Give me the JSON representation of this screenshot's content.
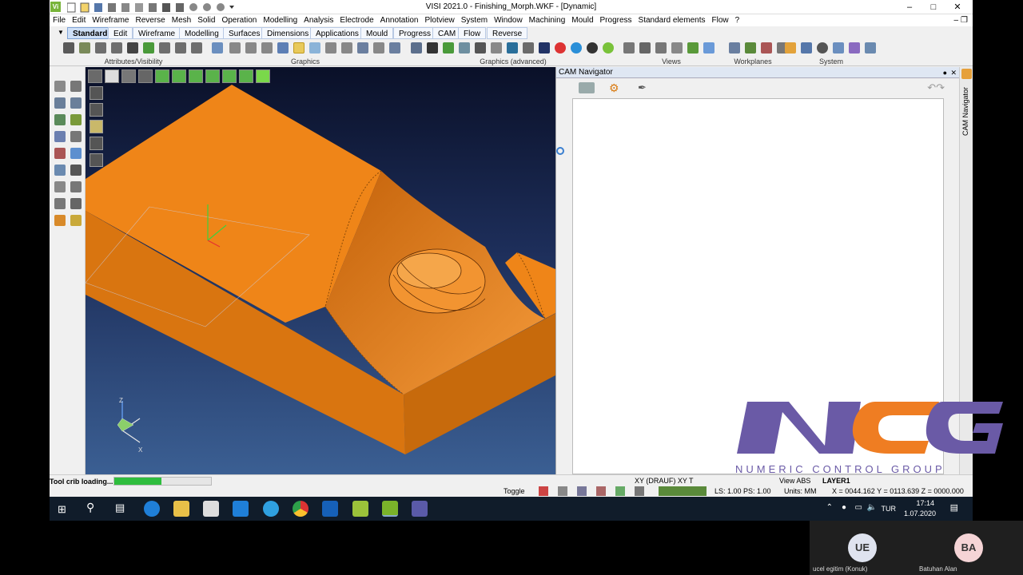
{
  "window": {
    "title": "VISI 2021.0 - Finishing_Morph.WKF - [Dynamic]",
    "logo_text": "Vi"
  },
  "menu": [
    "File",
    "Edit",
    "Wireframe",
    "Reverse",
    "Mesh",
    "Solid",
    "Operation",
    "Modelling",
    "Analysis",
    "Electrode",
    "Annotation",
    "Plotview",
    "System",
    "Window",
    "Machining",
    "Mould",
    "Progress",
    "Standard elements",
    "Flow",
    "?"
  ],
  "tabs": [
    {
      "label": "Standard",
      "active": true
    },
    {
      "label": "Edit"
    },
    {
      "label": "Wireframe"
    },
    {
      "label": "Modelling"
    },
    {
      "label": "Surfaces"
    },
    {
      "label": "Dimensions"
    },
    {
      "label": "Applications"
    },
    {
      "label": "Mould"
    },
    {
      "label": "Progress"
    },
    {
      "label": "CAM"
    },
    {
      "label": "Flow"
    },
    {
      "label": "Reverse"
    }
  ],
  "ribbon_groups": [
    "Attributes/Visibility",
    "Graphics",
    "Graphics (advanced)",
    "Views",
    "Workplanes",
    "System"
  ],
  "cam_navigator": {
    "title": "CAM Navigator",
    "side_label": "CAM Navigator"
  },
  "status": {
    "loading": "Tool crib loading...",
    "progress": 0.49,
    "toggle": "Toggle",
    "plane": "XY (DRAUF) XY T",
    "view": "View ABS",
    "layer": "LAYER1",
    "ls_ps": "LS: 1.00 PS: 1.00",
    "units": "Units: MM",
    "coords": "X = 0044.162 Y = 0113.639 Z = 0000.000"
  },
  "taskbar": {
    "lang": "TUR",
    "time": "17:14",
    "date": "1.07.2020"
  },
  "participants": [
    {
      "initials": "UE",
      "name": "ucel egitim (Konuk)",
      "color": "#dfe3ef"
    },
    {
      "initials": "BA",
      "name": "Batuhan Alan",
      "color": "#f5d4d6"
    }
  ],
  "watermark": {
    "big": "NCG",
    "sub": "NUMERIC CONTROL GROUP"
  },
  "colors": {
    "part": "#ee8a18",
    "progress": "#2fbd3e",
    "logo_purple": "#6a5aa6",
    "logo_orange": "#ef7d22"
  }
}
